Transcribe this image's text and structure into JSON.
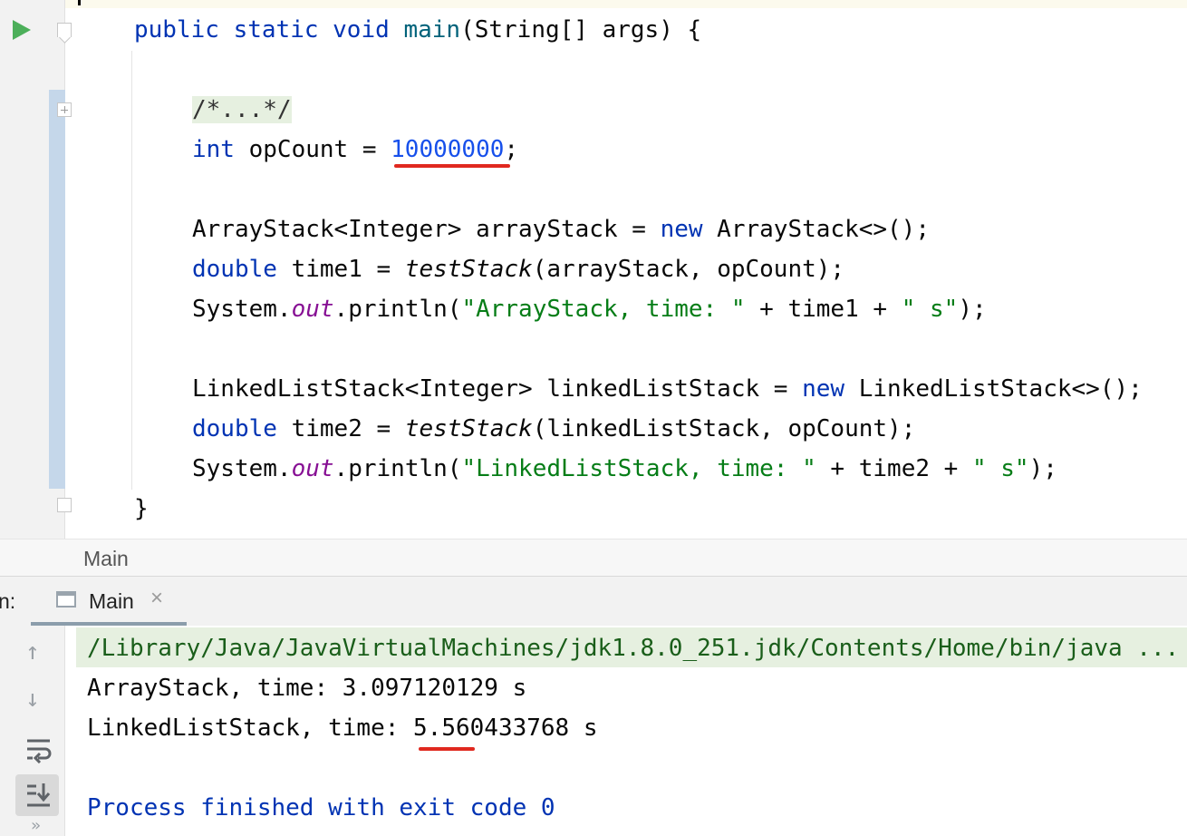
{
  "editor": {
    "lines": [
      [
        {
          "t": "public",
          "c": "kw"
        },
        {
          "t": " "
        },
        {
          "t": "static",
          "c": "kw"
        },
        {
          "t": " "
        },
        {
          "t": "void",
          "c": "kw"
        },
        {
          "t": " "
        },
        {
          "t": "main",
          "c": "mt"
        },
        {
          "t": "(String[] args) {"
        }
      ],
      [],
      [
        {
          "t": "/*...*/",
          "c": "fold-text"
        }
      ],
      [
        {
          "t": "int",
          "c": "kw"
        },
        {
          "t": " opCount = "
        },
        {
          "t": "10000000",
          "c": "num"
        },
        {
          "t": ";"
        }
      ],
      [],
      [
        {
          "t": "ArrayStack<Integer> arrayStack = "
        },
        {
          "t": "new",
          "c": "kw"
        },
        {
          "t": " ArrayStack<>();"
        }
      ],
      [
        {
          "t": "double",
          "c": "kw"
        },
        {
          "t": " time1 = "
        },
        {
          "t": "testStack",
          "c": "stat"
        },
        {
          "t": "(arrayStack, opCount);"
        }
      ],
      [
        {
          "t": "System."
        },
        {
          "t": "out",
          "c": "fld"
        },
        {
          "t": ".println("
        },
        {
          "t": "\"ArrayStack, time: \"",
          "c": "str"
        },
        {
          "t": " + time1 + "
        },
        {
          "t": "\" s\"",
          "c": "str"
        },
        {
          "t": ");"
        }
      ],
      [],
      [
        {
          "t": "LinkedListStack<Integer> linkedListStack = "
        },
        {
          "t": "new",
          "c": "kw"
        },
        {
          "t": " LinkedListStack<>();"
        }
      ],
      [
        {
          "t": "double",
          "c": "kw"
        },
        {
          "t": " time2 = "
        },
        {
          "t": "testStack",
          "c": "stat"
        },
        {
          "t": "(linkedListStack, opCount);"
        }
      ],
      [
        {
          "t": "System."
        },
        {
          "t": "out",
          "c": "fld"
        },
        {
          "t": ".println("
        },
        {
          "t": "\"LinkedListStack, time: \"",
          "c": "str"
        },
        {
          "t": " + time2 + "
        },
        {
          "t": "\" s\"",
          "c": "str"
        },
        {
          "t": ");"
        }
      ],
      [
        {
          "t": "}"
        }
      ]
    ],
    "colors": {
      "keyword": "#0033b3",
      "method": "#00627a",
      "number": "#1750eb",
      "string": "#067d17",
      "field": "#871094",
      "annotation_underline": "#e0281f"
    }
  },
  "breadcrumb": {
    "label": "Main"
  },
  "run_panel": {
    "label": "n:",
    "tab": {
      "label": "Main",
      "close": "×"
    }
  },
  "console": {
    "command": "/Library/Java/JavaVirtualMachines/jdk1.8.0_251.jdk/Contents/Home/bin/java ...",
    "output1": "ArrayStack, time: 3.097120129 s",
    "output2": "LinkedListStack, time: 5.560433768 s",
    "exit": "Process finished with exit code 0"
  },
  "toolbar": {
    "up": "↑",
    "down": "↓",
    "more": "»",
    "icons": [
      "arrow-up-icon",
      "arrow-down-icon",
      "soft-wrap-icon",
      "scroll-to-end-icon",
      "more-icon"
    ]
  }
}
